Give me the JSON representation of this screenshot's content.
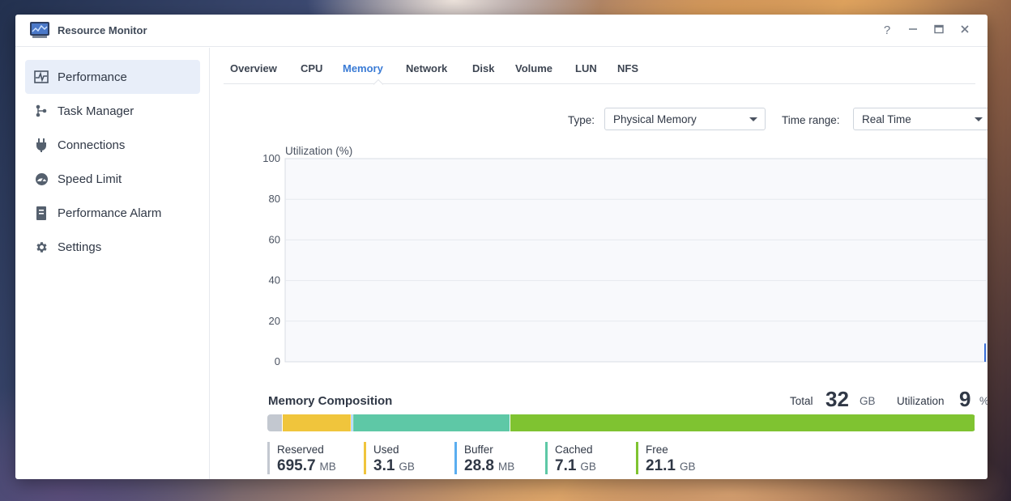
{
  "window": {
    "title": "Resource Monitor",
    "controls": {
      "help": "?",
      "minimize": "—",
      "maximize": "▣",
      "close": "✕"
    }
  },
  "sidebar": {
    "items": [
      {
        "label": "Performance",
        "icon": "pulse-chart-icon",
        "active": true
      },
      {
        "label": "Task Manager",
        "icon": "task-nodes-icon"
      },
      {
        "label": "Connections",
        "icon": "plug-icon"
      },
      {
        "label": "Speed Limit",
        "icon": "speedometer-icon"
      },
      {
        "label": "Performance Alarm",
        "icon": "notebook-icon"
      },
      {
        "label": "Settings",
        "icon": "gear-icon"
      }
    ]
  },
  "tabs": [
    {
      "label": "Overview"
    },
    {
      "label": "CPU"
    },
    {
      "label": "Memory",
      "active": true
    },
    {
      "label": "Network"
    },
    {
      "label": "Disk"
    },
    {
      "label": "Volume"
    },
    {
      "label": "LUN"
    },
    {
      "label": "NFS"
    }
  ],
  "filters": {
    "type_label": "Type:",
    "type_value": "Physical Memory",
    "range_label": "Time range:",
    "range_value": "Real Time"
  },
  "chart_data": {
    "type": "line",
    "ylabel": "Utilization (%)",
    "ylim": [
      0,
      100
    ],
    "yticks": [
      "100",
      "80",
      "60",
      "40",
      "20",
      "0"
    ],
    "series": [
      {
        "values": [
          0,
          9
        ]
      }
    ],
    "grid": true,
    "color": "#3a6fd8"
  },
  "composition": {
    "title": "Memory Composition",
    "total_label": "Total",
    "total_value": "32",
    "total_unit": "GB",
    "util_label": "Utilization",
    "util_value": "9",
    "util_unit": "%",
    "segments": [
      {
        "name": "Reserved",
        "value": "695.7",
        "unit": "MB",
        "color": "#c3c8d0",
        "fraction": 0.022
      },
      {
        "name": "Used",
        "value": "3.1",
        "unit": "GB",
        "color": "#f0c53c",
        "fraction": 0.097
      },
      {
        "name": "Buffer",
        "value": "28.8",
        "unit": "MB",
        "color": "#5aaef0",
        "fraction": 0.002
      },
      {
        "name": "Cached",
        "value": "7.1",
        "unit": "GB",
        "color": "#5ec8a6",
        "fraction": 0.222
      },
      {
        "name": "Free",
        "value": "21.1",
        "unit": "GB",
        "color": "#7fc331",
        "fraction": 0.657
      }
    ]
  }
}
